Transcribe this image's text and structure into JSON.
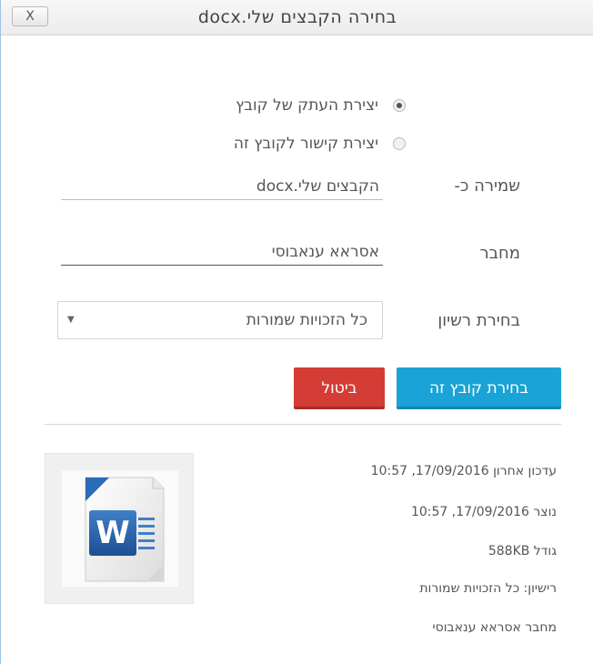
{
  "dialog": {
    "title": "בחירה הקבצים שלי.docx",
    "close_label": "X"
  },
  "options": {
    "copy_label": "יצירת העתק של קובץ",
    "link_label": "יצירת קישור לקובץ זה"
  },
  "form": {
    "save_as_label": "שמירה כ-",
    "save_as_value": "הקבצים שלי.docx",
    "author_label": "מחבר",
    "author_value": "אסראא ענאבוסי",
    "license_label": "בחירת רשיון",
    "license_value": "כל הזכויות שמורות"
  },
  "buttons": {
    "select_label": "בחירת קובץ זה",
    "cancel_label": "ביטול"
  },
  "info": {
    "modified": "עדכון אחרון 17/09/2016, 10:57",
    "created": "נוצר 17/09/2016, 10:57",
    "size": "גודל 588KB",
    "license": "רישיון: כל הזכויות שמורות",
    "author": "מחבר אסראא ענאבוסי"
  },
  "colors": {
    "primary": "#1aa3d6",
    "danger": "#d33d35",
    "word_blue": "#2b5797"
  },
  "icons": {
    "file_preview": "word-document-icon",
    "close": "close-icon",
    "dropdown": "chevron-down-icon"
  }
}
